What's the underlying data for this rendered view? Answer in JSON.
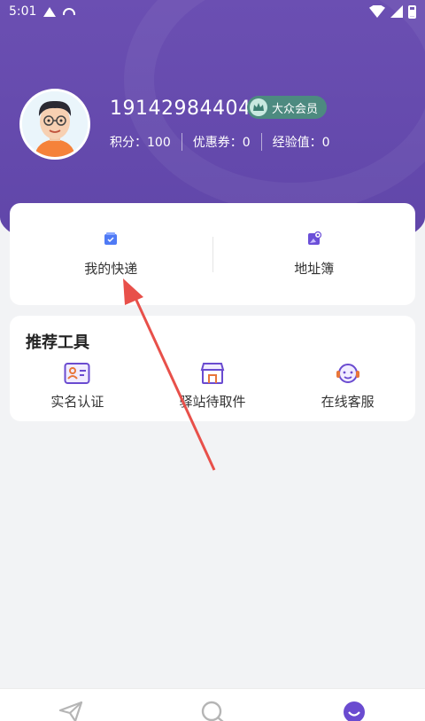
{
  "status_bar": {
    "time": "5:01"
  },
  "profile": {
    "phone": "19142984404",
    "vip_label": "大众会员",
    "stats": [
      {
        "label": "积分：100"
      },
      {
        "label": "优惠券：0"
      },
      {
        "label": "经验值：0"
      }
    ]
  },
  "quick_actions": [
    {
      "label": "我的快递",
      "icon": "package-icon"
    },
    {
      "label": "地址簿",
      "icon": "address-book-icon"
    }
  ],
  "tools_card": {
    "title": "推荐工具",
    "items": [
      {
        "label": "实名认证",
        "icon": "id-card-icon"
      },
      {
        "label": "驿站待取件",
        "icon": "station-icon"
      },
      {
        "label": "在线客服",
        "icon": "customer-service-icon"
      }
    ]
  },
  "tabbar": [
    {
      "icon": "send-icon"
    },
    {
      "icon": "search-icon"
    },
    {
      "icon": "profile-icon"
    }
  ],
  "colors": {
    "header": "#6b4fb2",
    "accent": "#6a4bd0",
    "annotation_arrow": "#e8504a"
  }
}
